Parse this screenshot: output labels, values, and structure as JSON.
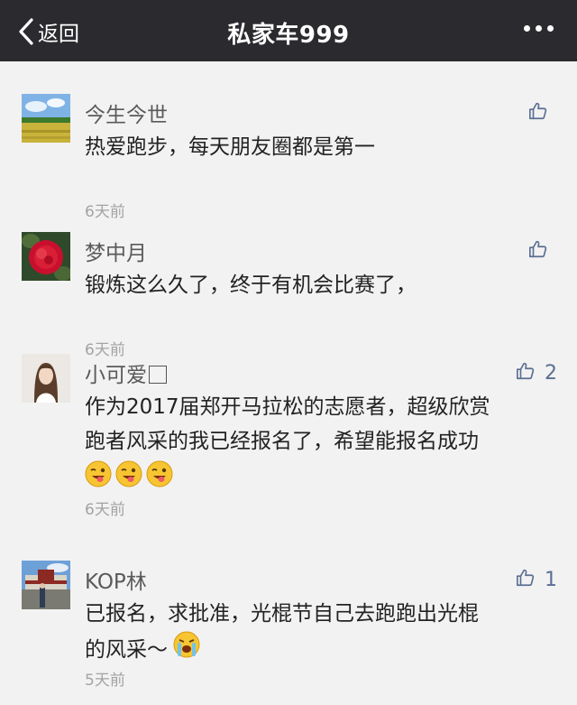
{
  "header": {
    "back_label": "返回",
    "title": "私家车999",
    "more_icon": "more-dots-icon"
  },
  "colors": {
    "header_bg": "#2b2b2f",
    "page_bg": "#f2f2f2",
    "like_icon": "#5b6f93",
    "time_text": "#a3a3a3"
  },
  "comments": [
    {
      "name": "今生今世",
      "lines": [
        "热爱跑步，每天朋友圈都是第一"
      ],
      "time": "6天前",
      "likes": "",
      "avatar": "landscape-field-avatar"
    },
    {
      "name": "梦中月",
      "lines": [
        "锻炼这么久了，终于有机会比赛了，"
      ],
      "time": "6天前",
      "likes": "",
      "avatar": "red-flower-avatar"
    },
    {
      "name": "小可爱",
      "lines": [
        "作为2017届郑开马拉松的志愿者，超级欣赏",
        "跑者风采的我已经报名了，希望能报名成功"
      ],
      "time": "6天前",
      "likes": "2",
      "emojis": [
        "wink-tongue-emoji",
        "wink-tongue-emoji",
        "wink-tongue-emoji"
      ],
      "avatar": "girl-portrait-avatar"
    },
    {
      "name": "KOP林",
      "lines": [
        "已报名，求批准，光棍节自己去跑跑出光棍",
        "的风采～"
      ],
      "time": "5天前",
      "likes": "1",
      "emojis": [
        "crying-emoji"
      ],
      "avatar": "palace-photo-avatar"
    }
  ]
}
